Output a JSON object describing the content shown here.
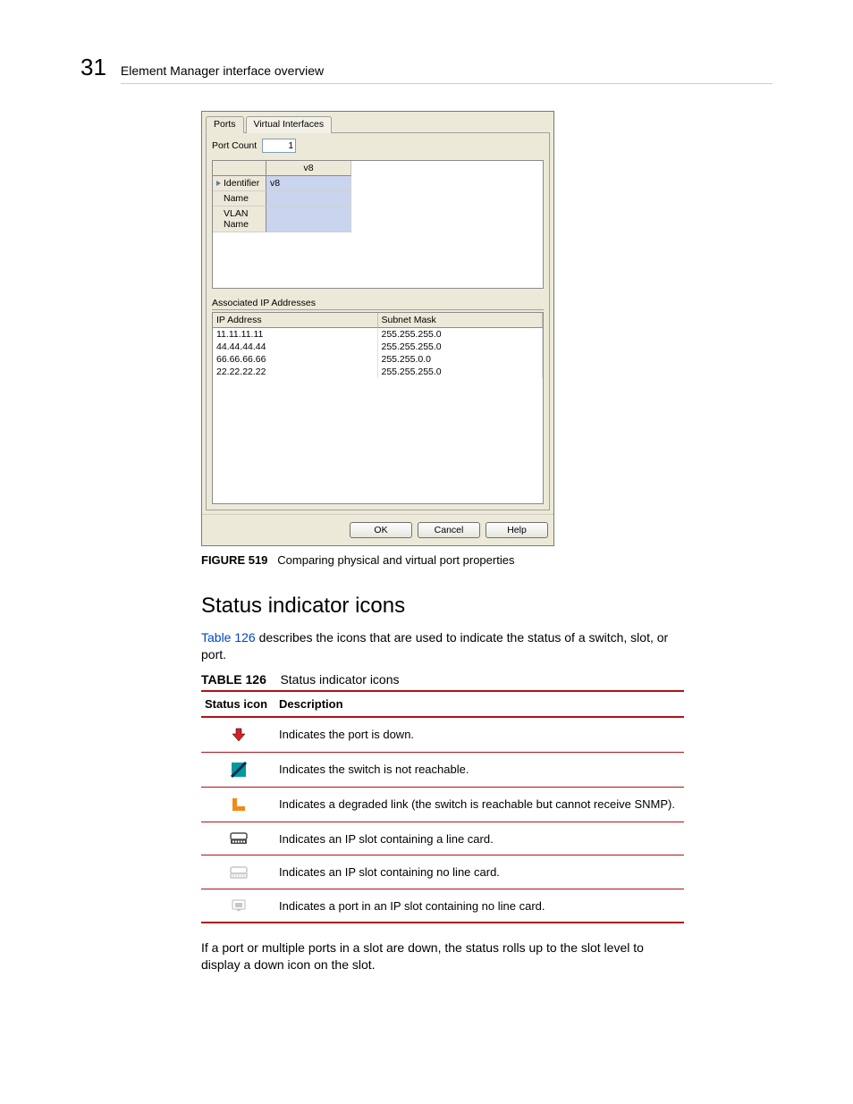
{
  "header": {
    "chapter": "31",
    "running_head": "Element Manager interface overview"
  },
  "screenshot": {
    "tabs": {
      "ports": "Ports",
      "vif": "Virtual Interfaces"
    },
    "port_count_label": "Port Count",
    "port_count_value": "1",
    "grid1": {
      "head_col": "v8",
      "rows": {
        "identifier": {
          "label": "Identifier",
          "value": "v8"
        },
        "name": {
          "label": "Name",
          "value": ""
        },
        "vlan": {
          "label": "VLAN Name",
          "value": ""
        }
      }
    },
    "assoc_title": "Associated IP Addresses",
    "grid2": {
      "headers": {
        "ip": "IP Address",
        "mask": "Subnet Mask"
      },
      "rows": [
        {
          "ip": "11.11.11.11",
          "mask": "255.255.255.0"
        },
        {
          "ip": "44.44.44.44",
          "mask": "255.255.255.0"
        },
        {
          "ip": "66.66.66.66",
          "mask": "255.255.0.0"
        },
        {
          "ip": "22.22.22.22",
          "mask": "255.255.255.0"
        }
      ]
    },
    "buttons": {
      "ok": "OK",
      "cancel": "Cancel",
      "help": "Help"
    }
  },
  "figure": {
    "label": "FIGURE 519",
    "caption": "Comparing physical and virtual port properties"
  },
  "h2": "Status indicator icons",
  "intro": {
    "linktext": "Table 126",
    "rest": " describes the icons that are used to indicate the status of a switch, slot, or port."
  },
  "table_title": {
    "label": "TABLE 126",
    "caption": "Status indicator icons"
  },
  "table": {
    "headers": {
      "icon": "Status icon",
      "desc": "Description"
    },
    "rows": [
      {
        "desc": "Indicates the port is down."
      },
      {
        "desc": "Indicates the switch is not reachable."
      },
      {
        "desc": "Indicates a degraded link (the switch is reachable but cannot receive SNMP)."
      },
      {
        "desc": "Indicates an IP slot containing a line card."
      },
      {
        "desc": "Indicates an IP slot containing no line card."
      },
      {
        "desc": "Indicates a port in an IP slot containing no line card."
      }
    ]
  },
  "outro": "If a port or multiple ports in a slot are down, the status rolls up to the slot level to display a down icon on the slot."
}
